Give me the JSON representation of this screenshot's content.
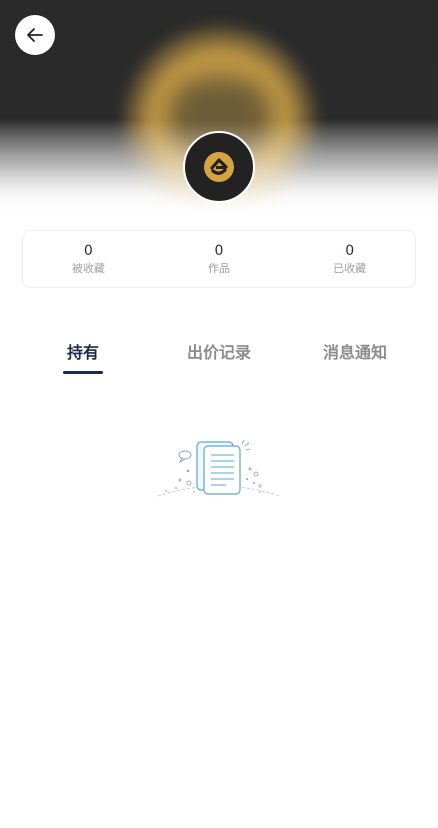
{
  "header": {
    "back_icon": "arrow-left-icon",
    "avatar_icon": "brand-logo-icon",
    "brand_color": "#d4a443"
  },
  "stats": [
    {
      "value": "0",
      "label": "被收藏"
    },
    {
      "value": "0",
      "label": "作品"
    },
    {
      "value": "0",
      "label": "已收藏"
    }
  ],
  "tabs": [
    {
      "label": "持有",
      "active": true
    },
    {
      "label": "出价记录",
      "active": false
    },
    {
      "label": "消息通知",
      "active": false
    }
  ],
  "empty_state": {
    "icon": "empty-documents-icon"
  },
  "colors": {
    "active_tab": "#1a2a4a",
    "inactive_tab": "#8c8c8c",
    "stat_value": "#1f2d4a",
    "stat_label": "#a0a0a0"
  }
}
